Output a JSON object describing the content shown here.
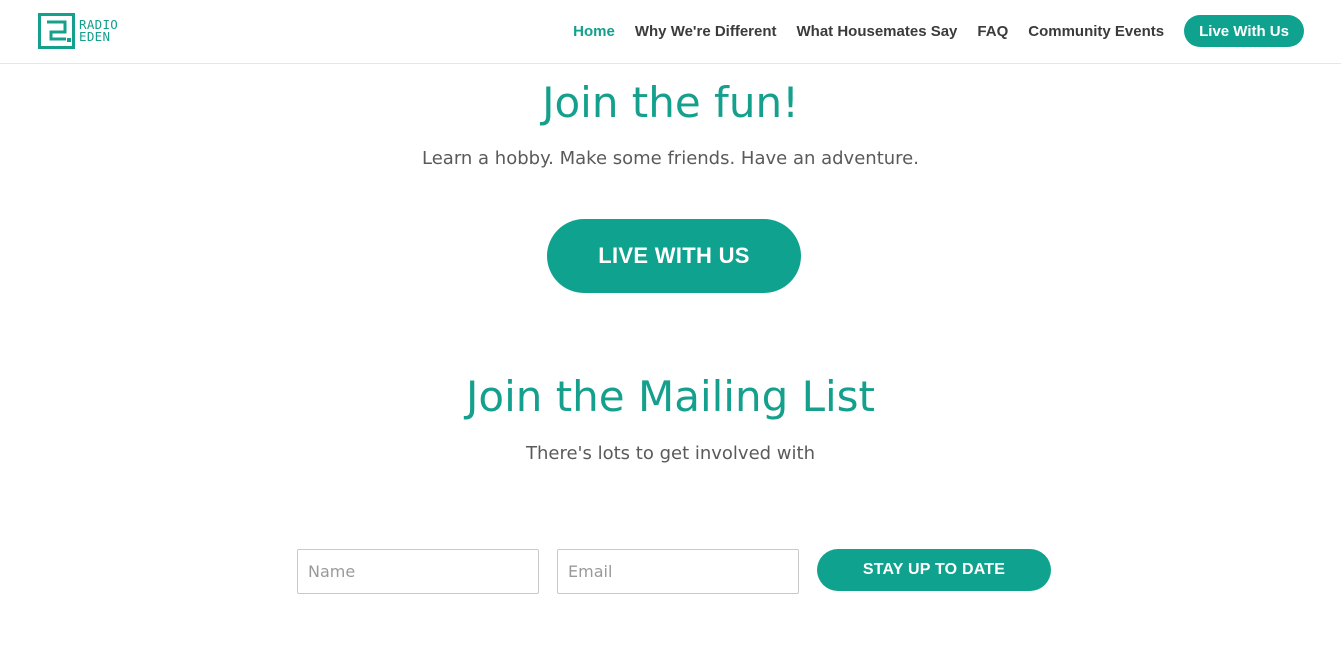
{
  "brand": {
    "line1": "RADIO",
    "line2": "EDEN",
    "color": "#14a08c",
    "icon": "eden-logo-icon"
  },
  "nav": {
    "items": [
      {
        "label": "Home",
        "active": true
      },
      {
        "label": "Why We're Different"
      },
      {
        "label": "What Housemates Say"
      },
      {
        "label": "FAQ"
      },
      {
        "label": "Community Events"
      }
    ],
    "cta_label": "Live With Us"
  },
  "hero": {
    "title": "Join the fun!",
    "subtitle": "Learn a hobby. Make some friends. Have an adventure.",
    "cta_label": "LIVE WITH US"
  },
  "mailing": {
    "title": "Join the Mailing List",
    "subtitle": "There's lots to get involved with",
    "name_placeholder": "Name",
    "email_placeholder": "Email",
    "submit_label": "STAY UP TO DATE"
  },
  "colors": {
    "accent": "#0fa38f",
    "text": "#3b3b3b",
    "muted": "#5a5a5a"
  }
}
